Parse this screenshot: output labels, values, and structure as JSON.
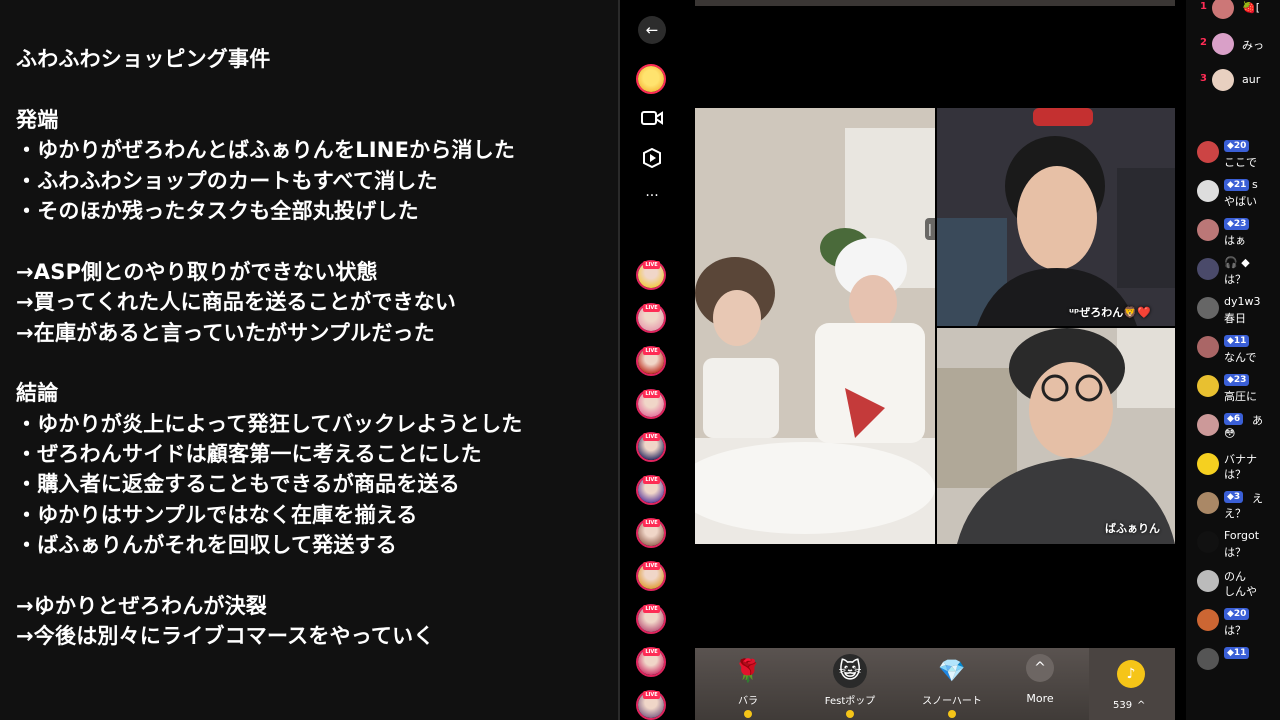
{
  "notes": {
    "lines": [
      "ふわふわショッピング事件",
      "",
      "発端",
      "・ゆかりがぜろわんとばふぁりんをLINEから消した",
      "・ふわふわショップのカートもすべて消した",
      "・そのほか残ったタスクも全部丸投げした",
      "",
      "→ASP側とのやり取りができない状態",
      "→買ってくれた人に商品を送ることができない",
      "→在庫があると言っていたがサンプルだった",
      "",
      "結論",
      "・ゆかりが炎上によって発狂してバックレようとした",
      "・ぜろわんサイドは顧客第一に考えることにした",
      "・購入者に返金することもできるが商品を送る",
      "・ゆかりはサンプルではなく在庫を揃える",
      "・ばふぁりんがそれを回収して発送する",
      "",
      "→ゆかりとぜろわんが決裂",
      "→今後は別々にライブコマースをやっていく"
    ]
  },
  "rail": {
    "back_icon": "←",
    "video_icon": "video-camera-icon",
    "play_icon": "play-icon",
    "more_icon": "···",
    "live_label": "LIVE",
    "live_avatar_colors": [
      "#f2c94c",
      "#e8a0b0",
      "#c0392b",
      "#e57aa0",
      "#3a3a6a",
      "#6a4aa0",
      "#a07060",
      "#e0a040",
      "#c06080",
      "#d04070",
      "#8a6a8a"
    ]
  },
  "video": {
    "pause_icon": "❘❘❘",
    "label_top": "ᵘᵖぜろわん🦁❤️",
    "label_bottom": "ばふぁりん"
  },
  "gifts": [
    {
      "name": "バラ",
      "icon": "🌹"
    },
    {
      "name": "Festポップ",
      "icon": "😺"
    },
    {
      "name": "スノーハート",
      "icon": "💎"
    },
    {
      "name": "More",
      "icon": "^"
    }
  ],
  "coins": {
    "value": "539",
    "caret": "^",
    "icon": "♪"
  },
  "ranking": [
    {
      "rank": "1",
      "name": "🍓[",
      "color": "#c77"
    },
    {
      "rank": "2",
      "name": "みっ",
      "color": "#d9a0c8"
    },
    {
      "rank": "3",
      "name": "aur",
      "color": "#e8d0c0"
    }
  ],
  "comments": [
    {
      "badge": "◆20",
      "text": "ここで",
      "color": "#c44"
    },
    {
      "badge": "◆21",
      "name_after": "s",
      "text": "やばい",
      "color": "#ddd"
    },
    {
      "badge": "◆23",
      "text": "はぁ",
      "color": "#b77"
    },
    {
      "name": "🎧 ◆",
      "text": "は？",
      "color": "#4a4a6a"
    },
    {
      "name": "dy1w3",
      "text": "春日",
      "color": "#666"
    },
    {
      "badge": "◆11",
      "name_after": "",
      "text": "なんで",
      "color": "#a66"
    },
    {
      "badge": "◆23",
      "text": "高圧に",
      "color": "#e8c030"
    },
    {
      "badge": "◆6",
      "name_after": "あ",
      "text": "😳",
      "color": "#c99"
    },
    {
      "name": "バナナ",
      "text": "は？",
      "color": "#f5d020"
    },
    {
      "badge": "◆3",
      "name_after": "え",
      "text": "え？",
      "color": "#a86"
    },
    {
      "name": "Forgot",
      "text": "は？",
      "color": "#111"
    },
    {
      "name": "のん",
      "text": "しんや",
      "color": "#bbb"
    },
    {
      "badge": "◆20",
      "text": "は？",
      "color": "#c63"
    },
    {
      "badge": "◆11",
      "text": "",
      "color": "#555"
    }
  ]
}
